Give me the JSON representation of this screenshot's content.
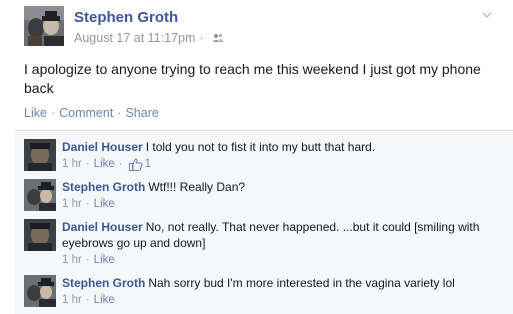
{
  "post": {
    "author": "Stephen Groth",
    "date": "August 17 at 11:17pm",
    "audience_icon": "friends-icon",
    "text": "I apologize to anyone trying to reach me this weekend I just got my phone back",
    "actions": {
      "like": "Like",
      "comment": "Comment",
      "share": "Share"
    }
  },
  "comments": [
    {
      "author": "Daniel Houser",
      "text": "I told you not to fist it into my butt that hard.",
      "time": "1 hr",
      "like_label": "Like",
      "like_count": "1"
    },
    {
      "author": "Stephen Groth",
      "text": "Wtf!!! Really Dan?",
      "time": "1 hr",
      "like_label": "Like"
    },
    {
      "author": "Daniel Houser",
      "text": "No, not really. That never happened. ...but it could [smiling with eyebrows go up and down]",
      "time": "1 hr",
      "like_label": "Like"
    },
    {
      "author": "Stephen Groth",
      "text": "Nah sorry bud I'm more interested in the vagina variety lol",
      "time": "1 hr",
      "like_label": "Like"
    }
  ],
  "colors": {
    "link": "#3b5998",
    "action": "#6d84b4",
    "meta": "#9197a3",
    "ufi_bg": "#f6f7f9"
  }
}
